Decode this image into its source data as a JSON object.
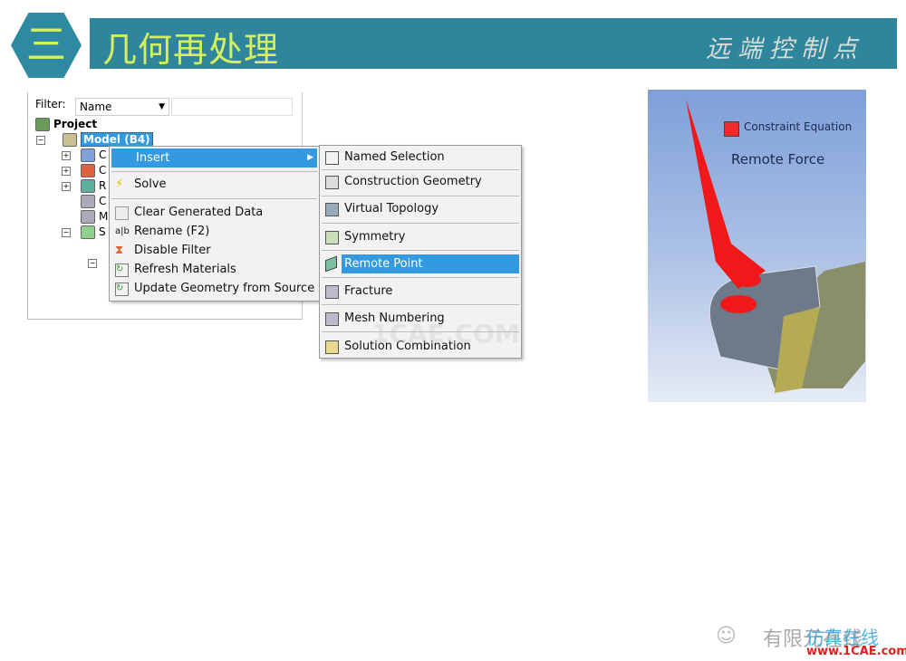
{
  "header": {
    "number": "三",
    "title": "几何再处理",
    "subtitle": "远端控制点"
  },
  "tree": {
    "filter_label": "Filter:",
    "filter_value": "Name",
    "project": "Project",
    "model": "Model (B4)",
    "rows_truncated": [
      "C",
      "C",
      "R",
      "C",
      "M",
      "S"
    ]
  },
  "context_menu": {
    "items": [
      {
        "label": "Insert",
        "icon": "none",
        "highlighted": true,
        "submenu": true
      },
      {
        "label": "Solve",
        "icon": "lightning-icon"
      },
      {
        "label": "Clear Generated Data",
        "icon": "eraser-icon"
      },
      {
        "label": "Rename (F2)",
        "icon": "rename-icon"
      },
      {
        "label": "Disable Filter",
        "icon": "filter-icon"
      },
      {
        "label": "Refresh Materials",
        "icon": "refresh-icon"
      },
      {
        "label": "Update Geometry from Source",
        "icon": "refresh-icon"
      }
    ]
  },
  "submenu": {
    "items": [
      {
        "label": "Named Selection",
        "icon": "named-selection-icon"
      },
      {
        "label": "Construction Geometry",
        "icon": "construction-geometry-icon"
      },
      {
        "label": "Virtual Topology",
        "icon": "virtual-topology-icon"
      },
      {
        "label": "Symmetry",
        "icon": "symmetry-icon"
      },
      {
        "label": "Remote Point",
        "icon": "remote-point-icon",
        "highlighted": true
      },
      {
        "label": "Fracture",
        "icon": "fracture-icon"
      },
      {
        "label": "Mesh Numbering",
        "icon": "mesh-numbering-icon"
      },
      {
        "label": "Solution Combination",
        "icon": "solution-combination-icon"
      }
    ]
  },
  "viewport": {
    "legend": "Constraint Equation",
    "label": "Remote Force",
    "legend_color": "#ee2a2a"
  },
  "watermark": {
    "text": "1CAE.COM",
    "logo_cn": "有限元在线",
    "logo_overlay": "仿真在线",
    "logo_url": "www.1CAE.com"
  },
  "colors": {
    "banner": "#2f869c",
    "title": "#d5ef5e",
    "highlight": "#3399e0"
  }
}
